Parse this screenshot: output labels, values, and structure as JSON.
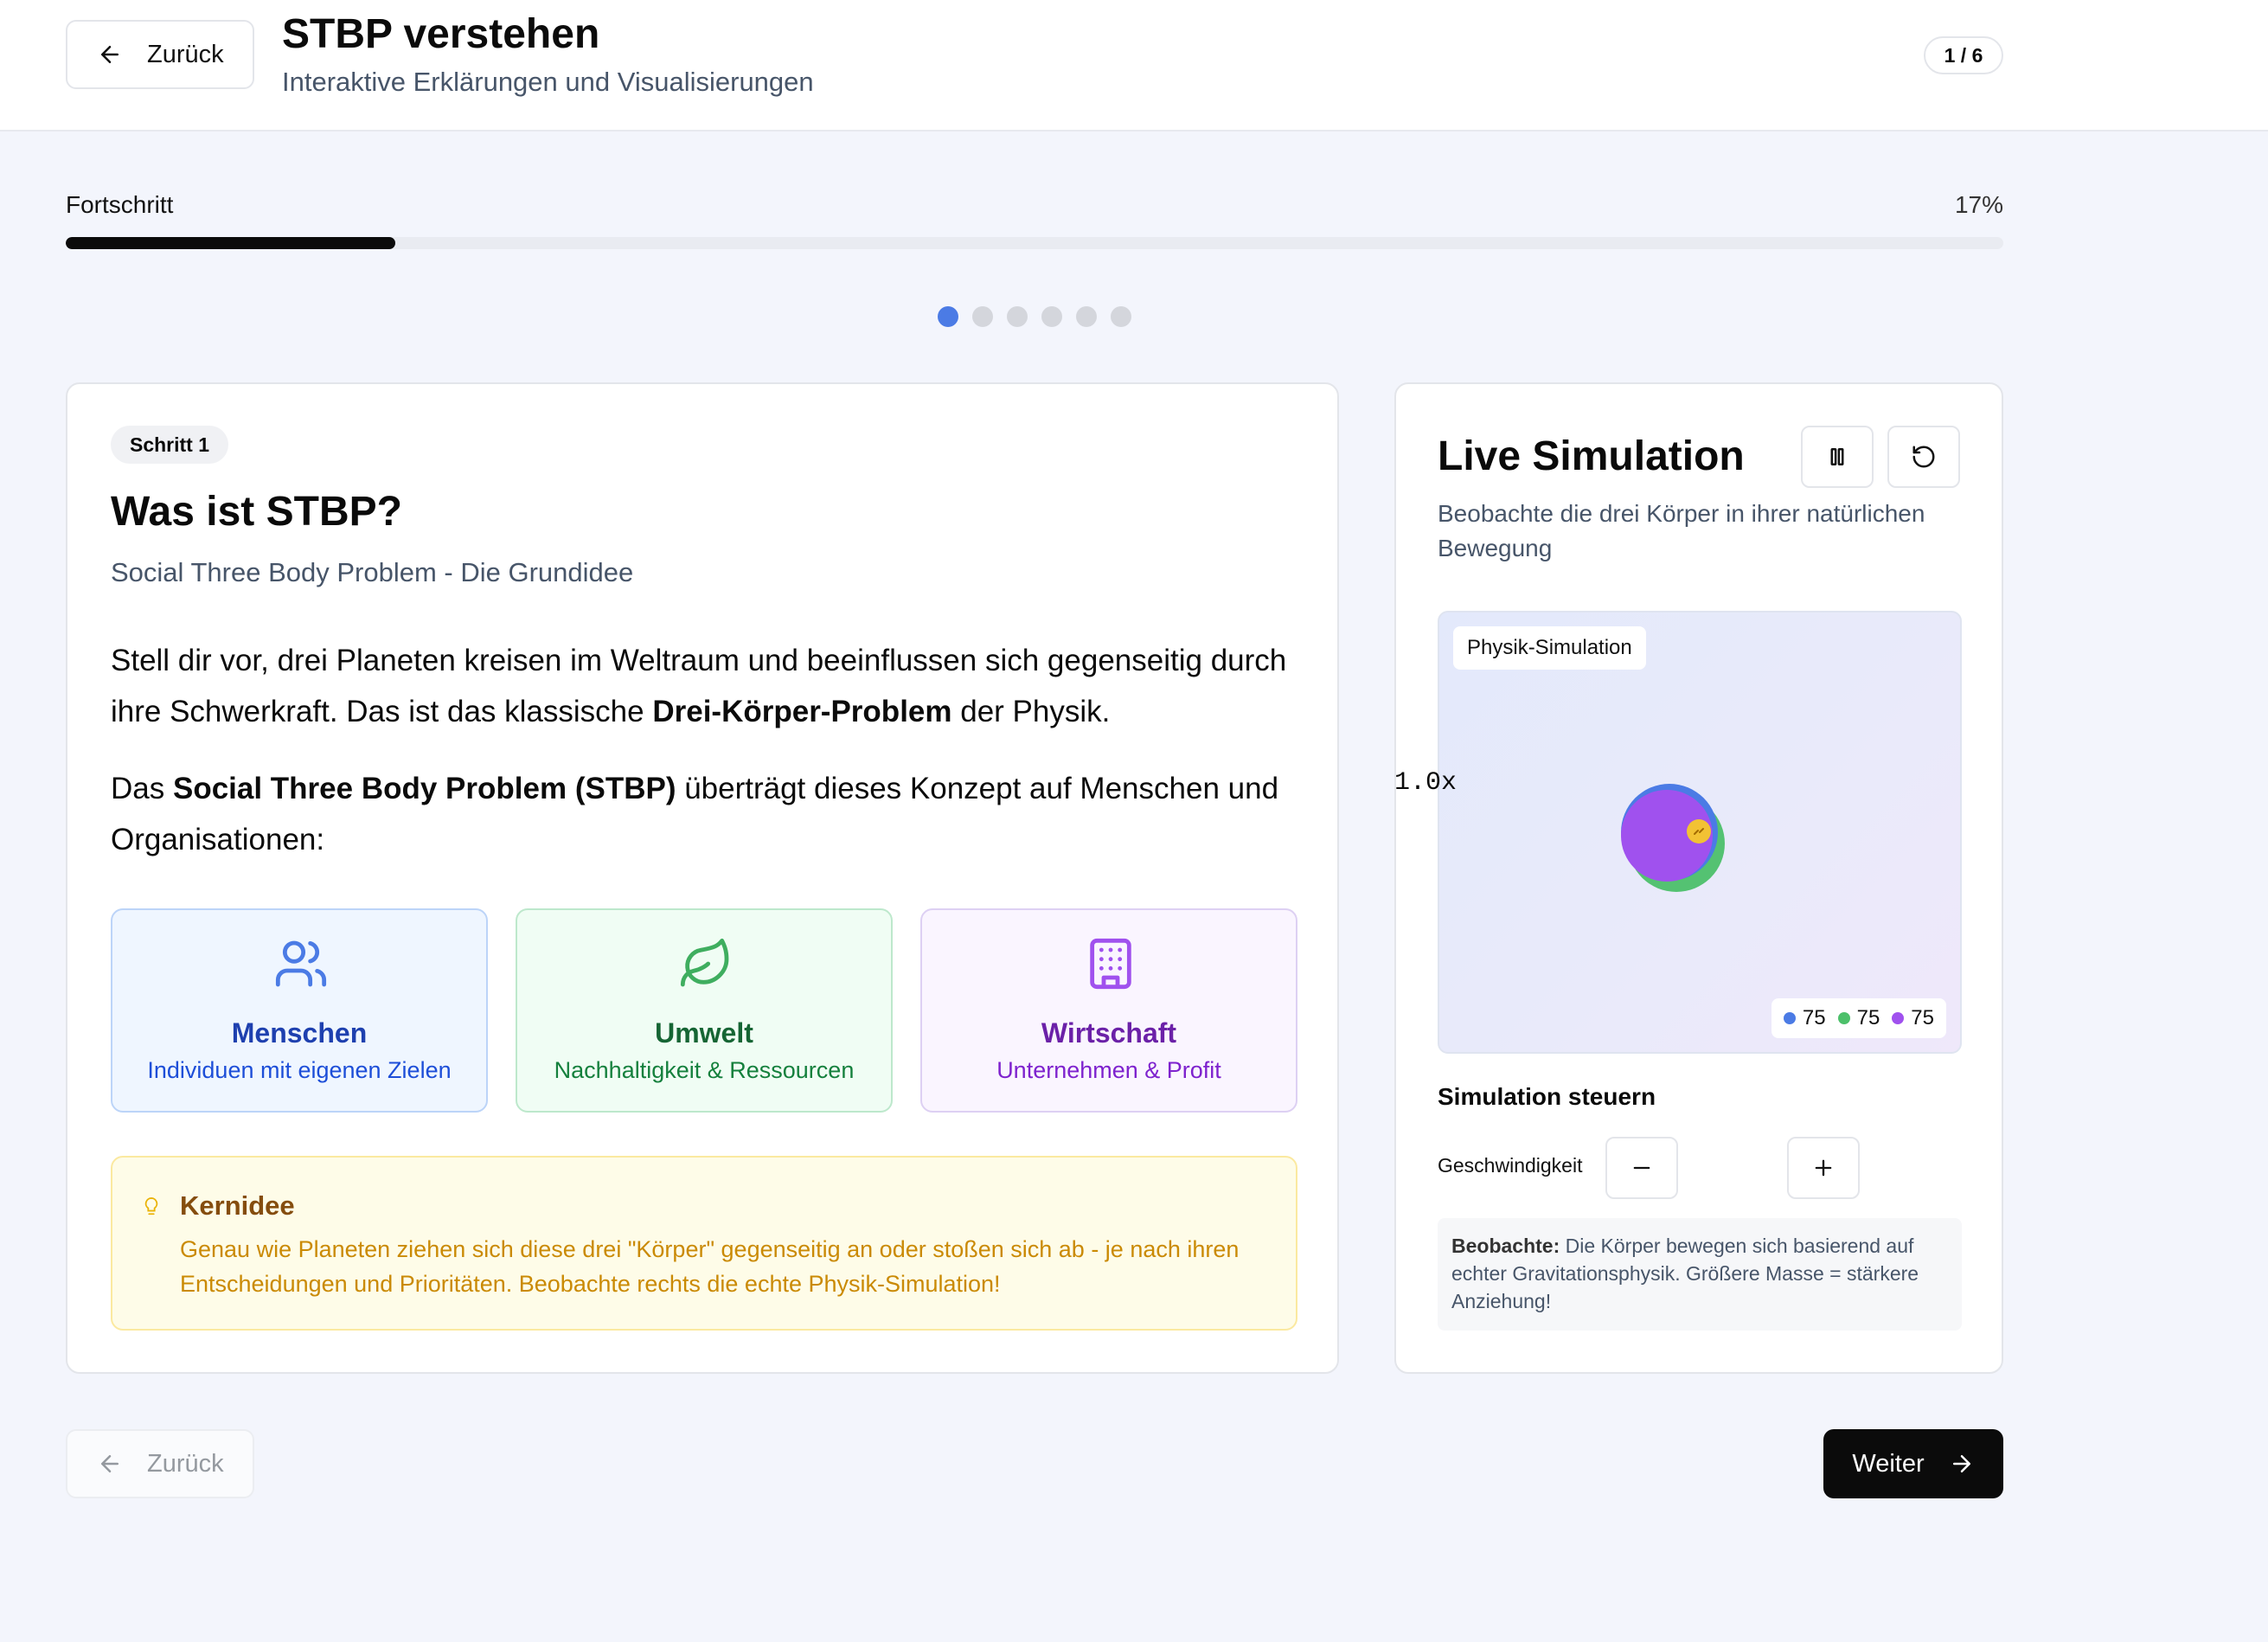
{
  "header": {
    "back_label": "Zurück",
    "title": "STBP verstehen",
    "subtitle": "Interaktive Erklärungen und Visualisierungen",
    "step_indicator": "1 / 6"
  },
  "progress": {
    "label": "Fortschritt",
    "percent_text": "17%",
    "value": 0.17,
    "steps_total": 6,
    "current_step": 1
  },
  "step": {
    "badge": "Schritt 1",
    "title": "Was ist STBP?",
    "subtitle": "Social Three Body Problem - Die Grundidee",
    "para1_a": "Stell dir vor, drei Planeten kreisen im Weltraum und beeinflussen sich gegenseitig durch ihre Schwerkraft. Das ist das klassische ",
    "para1_bold": "Drei-Körper-Problem",
    "para1_b": " der Physik.",
    "para2_a": "Das ",
    "para2_bold": "Social Three Body Problem (STBP)",
    "para2_b": " überträgt dieses Konzept auf Menschen und Organisationen:",
    "tiles": [
      {
        "title": "Menschen",
        "subtitle": "Individuen mit eigenen Zielen",
        "icon": "users-icon"
      },
      {
        "title": "Umwelt",
        "subtitle": "Nachhaltigkeit & Ressourcen",
        "icon": "leaf-icon"
      },
      {
        "title": "Wirtschaft",
        "subtitle": "Unternehmen & Profit",
        "icon": "building-icon"
      }
    ],
    "key_idea": {
      "title": "Kernidee",
      "text": "Genau wie Planeten ziehen sich diese drei \"Körper\" gegenseitig an oder stoßen sich ab - je nach ihren Entscheidungen und Prioritäten. Beobachte rechts die echte Physik-Simulation!",
      "icon": "lightbulb-icon"
    }
  },
  "simulation": {
    "title": "Live Simulation",
    "description": "Beobachte die drei Körper in ihrer natürlichen Bewegung",
    "canvas_label": "Physik-Simulation",
    "legend": [
      {
        "value": "75",
        "color": "#4b7be5"
      },
      {
        "value": "75",
        "color": "#4cc06a"
      },
      {
        "value": "75",
        "color": "#a051ee"
      }
    ],
    "controls_title": "Simulation steuern",
    "speed_label": "Geschwindigkeit",
    "speed_value": "1.0x",
    "note_bold": "Beobachte:",
    "note_text": " Die Körper bewegen sich basierend auf echter Gravitationsphysik. Größere Masse = stärkere Anziehung!"
  },
  "footer": {
    "back_label": "Zurück",
    "next_label": "Weiter"
  },
  "colors": {
    "accent": "#4b7be5",
    "primary": "#0b0b0b"
  }
}
